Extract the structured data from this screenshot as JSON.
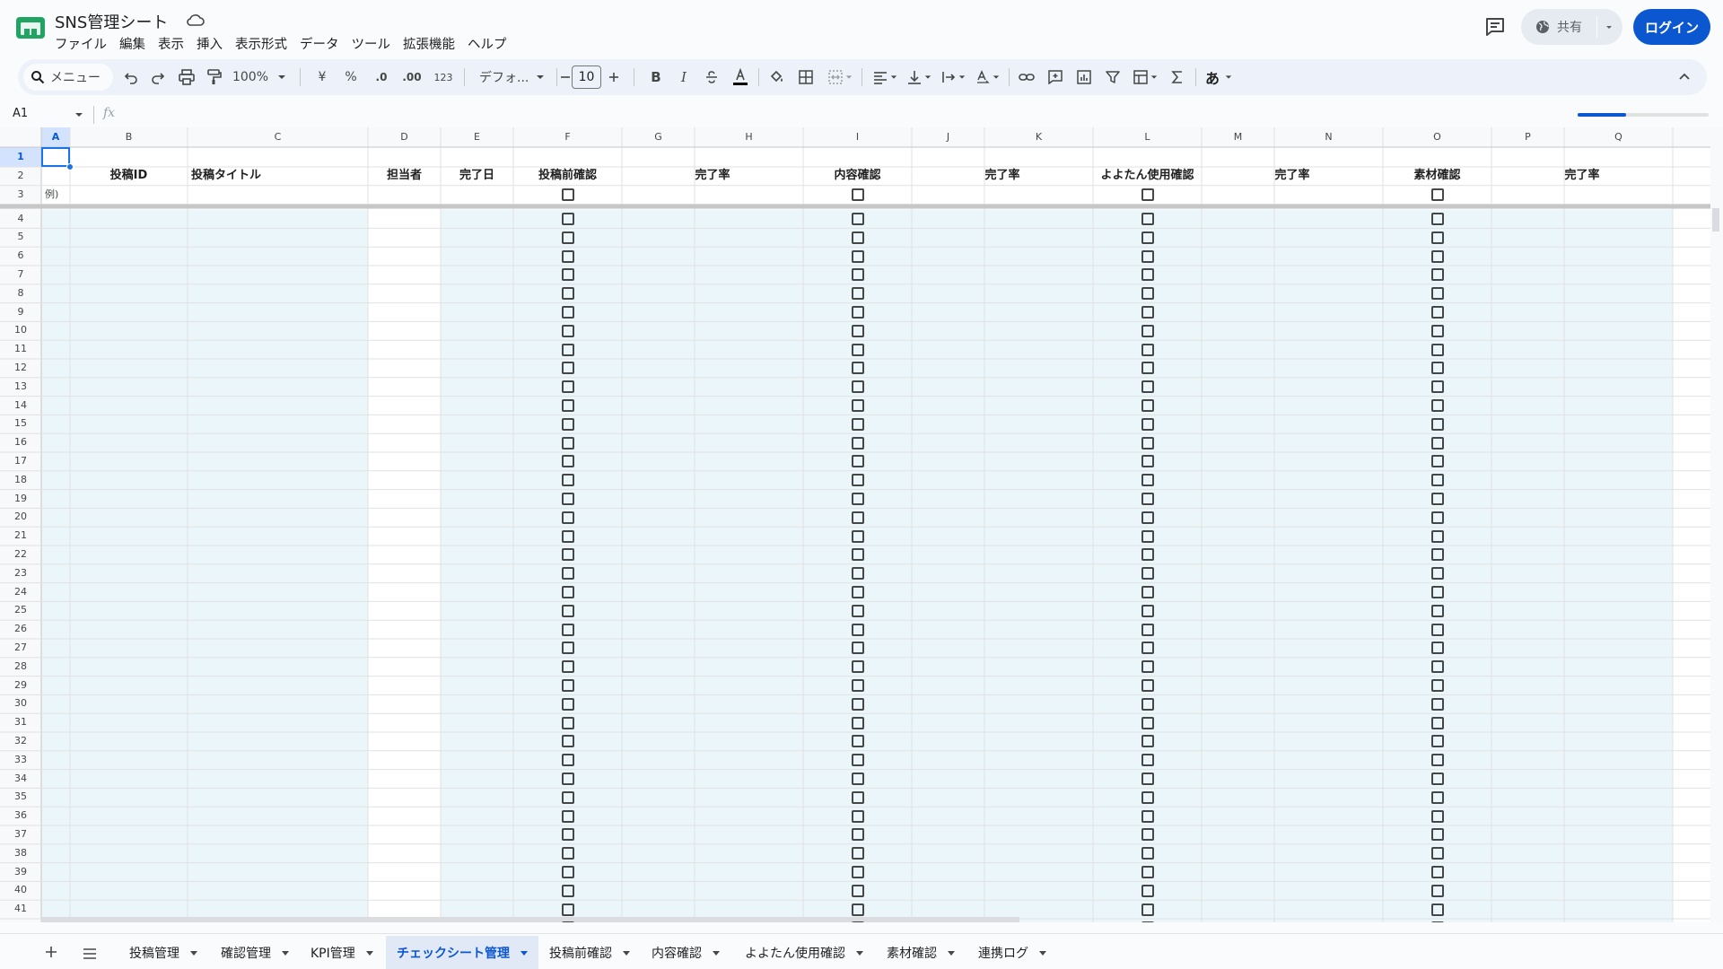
{
  "app": {
    "title": "SNS管理シート",
    "menus": [
      "ファイル",
      "編集",
      "表示",
      "挿入",
      "表示形式",
      "データ",
      "ツール",
      "拡張機能",
      "ヘルプ"
    ],
    "share_label": "共有",
    "login_label": "ログイン"
  },
  "toolbar": {
    "search_label": "メニュー",
    "zoom": "100%",
    "currency": "¥",
    "percent": "%",
    "dec_decrease": ".0",
    "dec_increase": ".00",
    "number_format": "123",
    "font": "デフォ...",
    "font_size": "10",
    "bold": "B",
    "italic": "I",
    "ime": "あ"
  },
  "formula_bar": {
    "cell_ref": "A1",
    "fx": "fx",
    "progress": 0.37
  },
  "grid": {
    "columns": [
      {
        "letter": "A",
        "selected": true
      },
      {
        "letter": "B"
      },
      {
        "letter": "C"
      },
      {
        "letter": "D"
      },
      {
        "letter": "E"
      },
      {
        "letter": "F"
      },
      {
        "letter": "G"
      },
      {
        "letter": "H"
      },
      {
        "letter": "I"
      },
      {
        "letter": "J"
      },
      {
        "letter": "K"
      },
      {
        "letter": "L"
      },
      {
        "letter": "M"
      },
      {
        "letter": "N"
      },
      {
        "letter": "O"
      },
      {
        "letter": "P"
      },
      {
        "letter": "Q"
      }
    ],
    "header_row": {
      "B": "投稿ID",
      "C": "投稿タイトル",
      "D": "担当者",
      "E": "完了日",
      "F": "投稿前確認",
      "H": "完了率",
      "I": "内容確認",
      "K": "完了率",
      "L": "よよたん使用確認",
      "N": "完了率",
      "O": "素材確認",
      "Q": "完了率"
    },
    "example_row_label": "例)",
    "checkbox_columns": [
      "F",
      "I",
      "L",
      "O"
    ],
    "first_row": 1,
    "last_visible_row": 41,
    "frozen_rows": 3,
    "tint_color": "#eaf6fa"
  },
  "sheets": {
    "active_index": 3,
    "tabs": [
      "投稿管理",
      "確認管理",
      "KPI管理",
      "チェックシート管理",
      "投稿前確認",
      "内容確認",
      "よよたん使用確認",
      "素材確認",
      "連携ログ"
    ]
  }
}
